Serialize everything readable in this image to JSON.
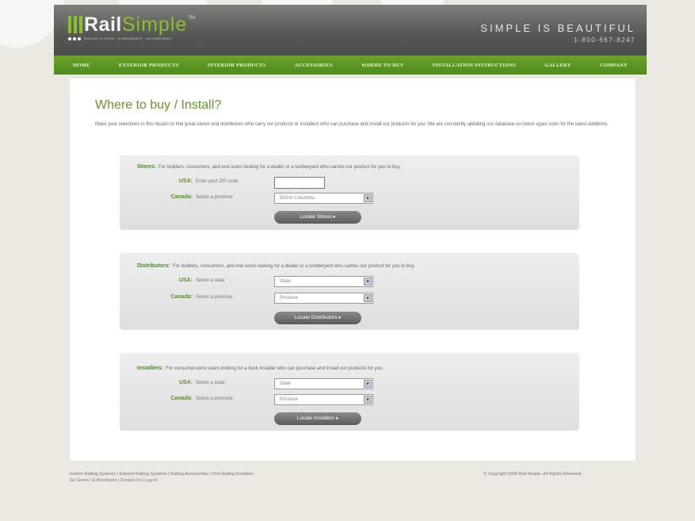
{
  "brand": {
    "logo_rail": "Rail",
    "logo_simple": "Simple",
    "logo_tm": "TM",
    "logo_tagline": "RAILING SYSTEM · COMPONENTS · ACCESSORIES",
    "slogan": "SIMPLE IS BEAUTIFUL",
    "phone": "1-800-667-8247",
    "accent_color": "#6aa42a",
    "header_color": "#555753"
  },
  "nav": {
    "items": [
      "HOME",
      "EXTERIOR PRODUCTS",
      "INTERIOR PRODUCTS",
      "ACCESSORIES",
      "WHERE TO BUY",
      "INSTALLATION INSTRUCTIONS",
      "GALLERY",
      "COMPANY"
    ]
  },
  "page": {
    "title": "Where to buy / Install?",
    "intro": "Make your selections in this locator to find great stores and distributors who carry our products or installers who can purchase and install our products for you. We are constantly updating our database so check again soon for the latest additions."
  },
  "stores": {
    "heading": "Stores:",
    "desc": "For builders, consumers, and end users looking for a dealer or a lumberyard who carries our product for you to buy.",
    "usa_label": "USA:",
    "usa_hint": "Enter your ZIP code:",
    "zip_value": "",
    "canada_label": "Canada:",
    "canada_hint": "Select a province:",
    "province_value": "British Columbia",
    "button": "Locate Stores"
  },
  "distributors": {
    "heading": "Distributors:",
    "desc": "For builders, consumers, and end users looking for a dealer or a lumberyard who carries our product for you to buy.",
    "usa_label": "USA:",
    "usa_hint": "Select a state:",
    "state_value": "State",
    "canada_label": "Canada:",
    "canada_hint": "Select a province:",
    "province_value": "Province",
    "button": "Locate Distributors"
  },
  "installers": {
    "heading": "Installers:",
    "desc": "For consumers/end users looking for a deck installer who can purchase and install our products for you.",
    "usa_label": "USA:",
    "usa_hint": "Select a state:",
    "state_value": "State",
    "canada_label": "Canada:",
    "canada_hint": "Select a province:",
    "province_value": "Province",
    "button": "Locate Installers"
  },
  "footer": {
    "links_row1": [
      "Interior Railing Systems",
      "Exterior Railing Systems",
      "Railing Accessories",
      "Find Railing Installers"
    ],
    "links_row2": [
      "Go Green",
      "E-Brochures",
      "Contact Us",
      "Log In"
    ],
    "separator": "|",
    "copyright": "© Copyright 2000 Rail Simple. All Rights Reserved."
  },
  "icons": {
    "dropdown_arrow": "chevron-down-icon",
    "button_arrow": "arrow-right-icon"
  }
}
